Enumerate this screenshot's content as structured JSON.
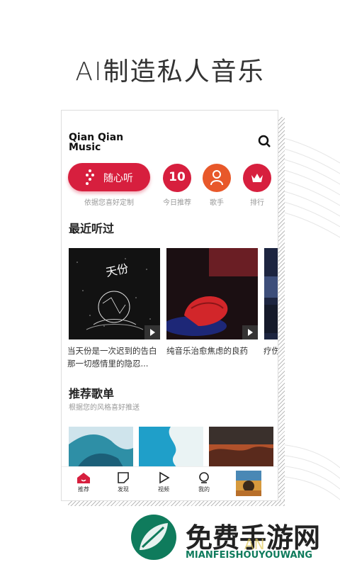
{
  "headline": "AI制造私人音乐",
  "app": {
    "logo_line1": "Qian Qian",
    "logo_line2": "Music",
    "quick_actions": [
      {
        "label": "随心听",
        "caption": "依据您喜好定制"
      },
      {
        "label": "10",
        "caption": "今日推荐"
      },
      {
        "label": "",
        "caption": "歌手"
      },
      {
        "label": "",
        "caption": "排行"
      }
    ],
    "recent": {
      "title": "最近听过",
      "items": [
        {
          "caption_line1": "当天份是一次迟到的告白",
          "caption_line2": "那一切感情里的隐忍...",
          "cover_text": "天份"
        },
        {
          "caption_line1": "纯音乐治愈焦虑的良药",
          "caption_line2": ""
        },
        {
          "caption_line1": "疗伤",
          "caption_line2": ""
        }
      ]
    },
    "playlists": {
      "title": "推荐歌单",
      "subtitle": "根据您的风格喜好推送"
    },
    "tabs": [
      {
        "label": "推荐"
      },
      {
        "label": "发现"
      },
      {
        "label": "视频"
      },
      {
        "label": "我的"
      }
    ]
  },
  "footer": {
    "title": "免费手游网",
    "subtitle": "MIANFEISHOUYOUWANG",
    "watermark": "AN"
  },
  "colors": {
    "accent": "#d71f3e",
    "orange": "#e8582a",
    "brand_green": "#0f7b5c"
  }
}
